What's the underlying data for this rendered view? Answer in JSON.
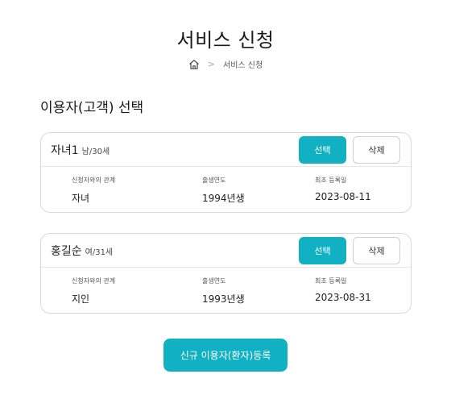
{
  "header": {
    "title": "서비스 신청",
    "breadcrumb": {
      "home_icon": "home-icon",
      "current": "서비스 신청"
    }
  },
  "section": {
    "title": "이용자(고객) 선택"
  },
  "users": [
    {
      "name": "자녀1",
      "meta": "남/30세",
      "select_label": "선택",
      "delete_label": "삭제",
      "fields": [
        {
          "label": "신청자와의 관계",
          "value": "자녀"
        },
        {
          "label": "출생연도",
          "value": "1994년생"
        },
        {
          "label": "최초 등록일",
          "value": "2023-08-11"
        }
      ]
    },
    {
      "name": "홍길순",
      "meta": "여/31세",
      "select_label": "선택",
      "delete_label": "삭제",
      "fields": [
        {
          "label": "신청자와의 관계",
          "value": "지인"
        },
        {
          "label": "출생연도",
          "value": "1993년생"
        },
        {
          "label": "최초 등록일",
          "value": "2023-08-31"
        }
      ]
    }
  ],
  "register_button": {
    "label": "신규 이용자(환자)등록"
  },
  "colors": {
    "accent": "#12b0c3",
    "border": "#d9d9d9"
  }
}
